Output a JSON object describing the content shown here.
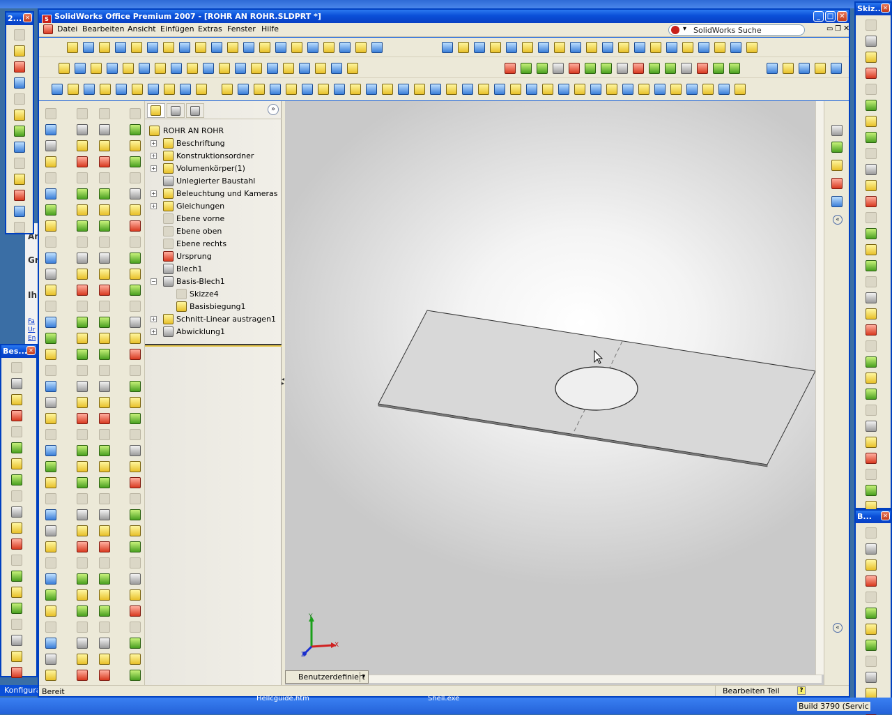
{
  "app": {
    "title": "SolidWorks Office Premium 2007 - [ROHR AN ROHR.SLDPRT *]",
    "search_label": "SolidWorks Suche"
  },
  "menu": [
    "Datei",
    "Bearbeiten",
    "Ansicht",
    "Einfügen",
    "Extras",
    "Fenster",
    "Hilfe"
  ],
  "floating": {
    "left_top_title": "2...",
    "left_mid_title": "Bes...",
    "right_top_title": "Skiz...",
    "right_bottom_title": "B..."
  },
  "tree": {
    "root": "ROHR AN ROHR",
    "items": [
      {
        "label": "Beschriftung",
        "expand": "+",
        "icon": "annotation"
      },
      {
        "label": "Konstruktionsordner",
        "expand": "+",
        "icon": "folder-diamond"
      },
      {
        "label": "Volumenkörper(1)",
        "expand": "+",
        "icon": "solid-bodies"
      },
      {
        "label": "Unlegierter Baustahl",
        "expand": "",
        "icon": "material"
      },
      {
        "label": "Beleuchtung und Kameras",
        "expand": "+",
        "icon": "lights"
      },
      {
        "label": "Gleichungen",
        "expand": "+",
        "icon": "equations"
      },
      {
        "label": "Ebene vorne",
        "expand": "",
        "icon": "plane"
      },
      {
        "label": "Ebene oben",
        "expand": "",
        "icon": "plane"
      },
      {
        "label": "Ebene rechts",
        "expand": "",
        "icon": "plane"
      },
      {
        "label": "Ursprung",
        "expand": "",
        "icon": "origin"
      },
      {
        "label": "Blech1",
        "expand": "",
        "icon": "sheet-metal"
      },
      {
        "label": "Basis-Blech1",
        "expand": "−",
        "icon": "base-flange"
      },
      {
        "label": "Skizze4",
        "expand": "",
        "icon": "sketch",
        "indent": true
      },
      {
        "label": "Basisbiegung1",
        "expand": "",
        "icon": "bend",
        "indent": true
      },
      {
        "label": "Schnitt-Linear austragen1",
        "expand": "+",
        "icon": "cut-extrude"
      },
      {
        "label": "Abwicklung1",
        "expand": "+",
        "icon": "flatten"
      }
    ]
  },
  "viewport": {
    "config_dropdown": "Benutzerdefiniert",
    "axis_x": "X",
    "axis_y": "Y",
    "axis_z": "Z"
  },
  "status": {
    "left": "Bereit",
    "right": "Bearbeiten Teil",
    "taskbar_left": "Konfigura",
    "taskbar_build": "Build 3790 (Servic",
    "taskbar_item1": "Hellcguide.htm",
    "taskbar_item2": "Shell.exe"
  },
  "background": {
    "left_letters": [
      "An",
      "Gr",
      "Ih",
      "Fa",
      "Ur",
      "En"
    ]
  }
}
